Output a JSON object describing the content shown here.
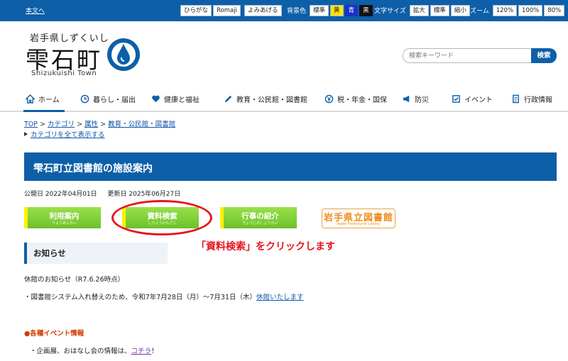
{
  "topbar": {
    "skip_link": "本文へ",
    "hiragana": "ひらがな",
    "romaji": "Romaji",
    "read_aloud": "よみあげる",
    "bg_label": "背景色",
    "bg_standard": "標準",
    "bg_yellow": "黄",
    "bg_blue": "青",
    "bg_black": "黒",
    "text_size_label": "文字サイズ",
    "size_large": "拡大",
    "size_standard": "標準",
    "size_small": "縮小",
    "zoom_label": "ズーム",
    "zoom_120": "120%",
    "zoom_100": "100%",
    "zoom_80": "80%"
  },
  "header": {
    "logo_sub": "岩手県しずくいし",
    "logo_main": "雫石町",
    "logo_en": "Shizukuishi Town",
    "search_placeholder": "検索キーワード",
    "search_button": "検索"
  },
  "nav": {
    "items": [
      "ホーム",
      "暮らし・届出",
      "健康と福祉",
      "教育・公民館・図書館",
      "税・年金・国保",
      "防災",
      "イベント",
      "行政情報"
    ]
  },
  "breadcrumb": {
    "top": "TOP",
    "sep": ">",
    "category": "カテゴリ",
    "attribute": "属性",
    "current": "教育・公民館・図書館",
    "show_all": "カテゴリを全て表示する"
  },
  "page": {
    "title": "雫石町立図書館の施設案内",
    "published": "公開日 2022年04月01日",
    "updated": "更新日 2025年06月27日"
  },
  "buttons": {
    "usage": {
      "label": "利用案内",
      "kana": "りようあんない"
    },
    "search": {
      "label": "資料検索",
      "kana": "しりょうけんさく"
    },
    "events": {
      "label": "行事の紹介",
      "kana": "ぎょうじのしょうかい"
    },
    "pref_library": {
      "label": "岩手県立図書館",
      "en": "Iwate Prefectural Library"
    }
  },
  "annotation": "「資料検索」をクリックします",
  "notice": {
    "heading": "お知らせ",
    "closure_title": "休館のお知らせ（R7.6.26時点）",
    "closure_text": "・図書館システム入れ替えのため、令和7年7月28日（月）～7月31日（木）",
    "closure_link": "休館いたします",
    "event_heading": "●各種イベント情報",
    "event_text_before": "・企画展、おはなし会の情報は、",
    "event_link": "コチラ",
    "event_text_after": "！"
  },
  "colors": {
    "brand_blue": "#0d5fa8",
    "button_green": "#7ccc34",
    "annotation_red": "#e8141c",
    "pref_orange": "#f08a18"
  }
}
